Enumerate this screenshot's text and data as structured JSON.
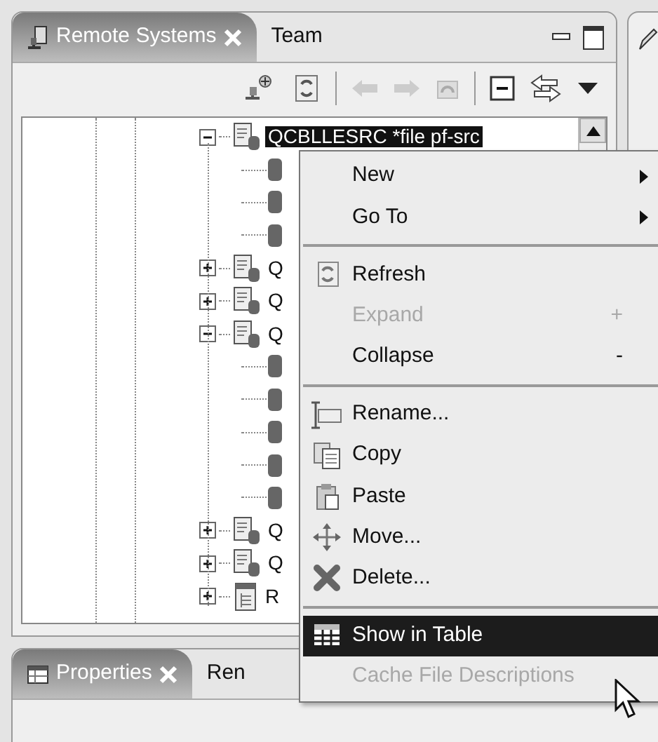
{
  "view_tabs": [
    {
      "label": "Remote Systems",
      "selected": true,
      "closable": true
    },
    {
      "label": "Team",
      "selected": false,
      "closable": false
    }
  ],
  "tree": [
    {
      "kind": "source-file",
      "label": "QCBLLESRC *file pf-src",
      "expanded": true,
      "selected": true,
      "children": [
        {
          "kind": "member"
        },
        {
          "kind": "member"
        },
        {
          "kind": "member"
        }
      ]
    },
    {
      "kind": "source-file",
      "label": "Q",
      "expanded": false,
      "selected": false
    },
    {
      "kind": "source-file",
      "label": "Q",
      "expanded": false,
      "selected": false
    },
    {
      "kind": "source-file",
      "label": "Q",
      "expanded": true,
      "selected": false,
      "children": [
        {
          "kind": "member"
        },
        {
          "kind": "member"
        },
        {
          "kind": "member"
        },
        {
          "kind": "member"
        },
        {
          "kind": "member"
        }
      ]
    },
    {
      "kind": "source-file",
      "label": "Q",
      "expanded": false,
      "selected": false
    },
    {
      "kind": "source-file",
      "label": "Q",
      "expanded": false,
      "selected": false
    },
    {
      "kind": "data-file",
      "label": "R",
      "expanded": false,
      "selected": false
    }
  ],
  "bottom_tabs": [
    {
      "label": "Properties",
      "selected": true,
      "closable": true
    },
    {
      "label": "Ren",
      "selected": false,
      "closable": false
    }
  ],
  "context_menu": [
    {
      "kind": "item",
      "label": "New",
      "submenu": true,
      "disabled": false,
      "selected": false
    },
    {
      "kind": "item",
      "label": "Go To",
      "submenu": true,
      "disabled": false,
      "selected": false
    },
    {
      "kind": "separator"
    },
    {
      "kind": "item",
      "label": "Refresh",
      "submenu": false,
      "disabled": false,
      "selected": false
    },
    {
      "kind": "item",
      "label": "Expand",
      "shortcut": "+",
      "submenu": false,
      "disabled": true,
      "selected": false
    },
    {
      "kind": "item",
      "label": "Collapse",
      "shortcut": "-",
      "submenu": false,
      "disabled": false,
      "selected": false
    },
    {
      "kind": "separator"
    },
    {
      "kind": "item",
      "label": "Rename...",
      "submenu": false,
      "disabled": false,
      "selected": false
    },
    {
      "kind": "item",
      "label": "Copy",
      "submenu": false,
      "disabled": false,
      "selected": false
    },
    {
      "kind": "item",
      "label": "Paste",
      "submenu": false,
      "disabled": false,
      "selected": false
    },
    {
      "kind": "item",
      "label": "Move...",
      "submenu": false,
      "disabled": false,
      "selected": false
    },
    {
      "kind": "item",
      "label": "Delete...",
      "submenu": false,
      "disabled": false,
      "selected": false
    },
    {
      "kind": "separator"
    },
    {
      "kind": "item",
      "label": "Show in Table",
      "submenu": false,
      "disabled": false,
      "selected": true
    },
    {
      "kind": "item",
      "label": "Cache File Descriptions",
      "submenu": false,
      "disabled": true,
      "selected": false
    }
  ]
}
